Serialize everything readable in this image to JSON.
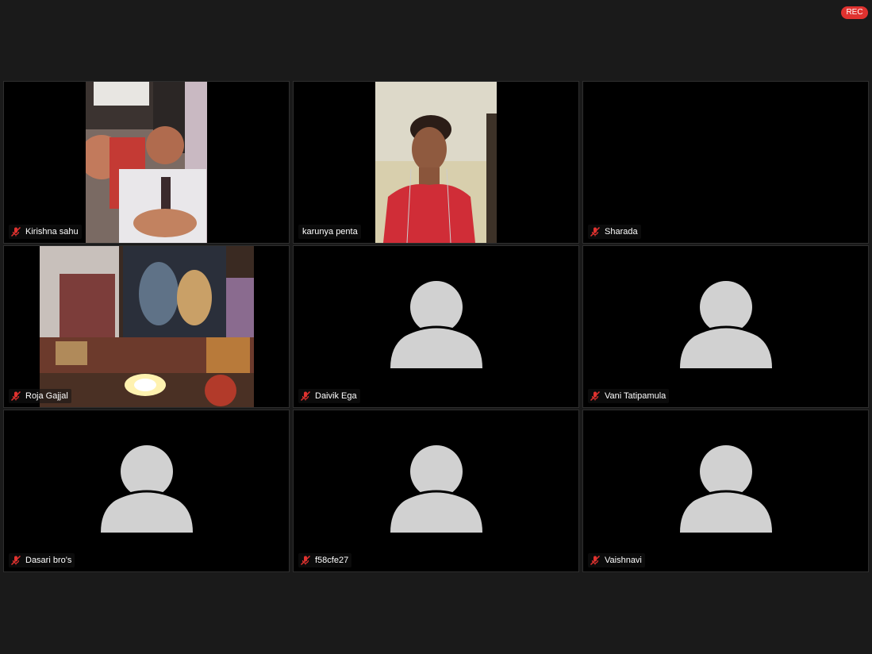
{
  "recording": {
    "label": "REC",
    "color": "#e0322f"
  },
  "participants": [
    {
      "name": "Kirishna sahu",
      "muted": true,
      "video": true
    },
    {
      "name": "karunya penta",
      "muted": false,
      "video": true
    },
    {
      "name": "Sharada",
      "muted": true,
      "video": false
    },
    {
      "name": "Roja Gajjal",
      "muted": true,
      "video": true
    },
    {
      "name": "Daivik Ega",
      "muted": true,
      "video": false
    },
    {
      "name": "Vani Tatipamula",
      "muted": true,
      "video": false
    },
    {
      "name": "Dasari bro's",
      "muted": true,
      "video": false
    },
    {
      "name": "f58cfe27",
      "muted": true,
      "video": false
    },
    {
      "name": "Vaishnavi",
      "muted": true,
      "video": false
    }
  ],
  "icons": {
    "muted_mic": "muted-mic-icon",
    "avatar": "avatar-placeholder-icon"
  },
  "colors": {
    "background": "#1a1a1a",
    "tile": "#000000",
    "avatar": "#d1d1d1",
    "muted": "#e0322f"
  }
}
